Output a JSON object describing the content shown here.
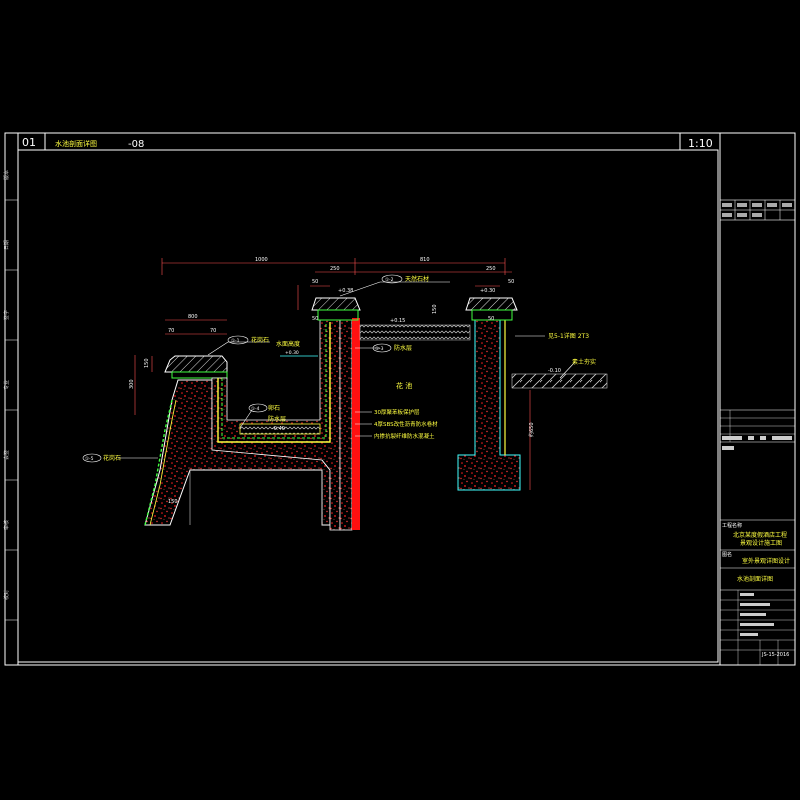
{
  "header": {
    "sheet_no": "01",
    "title": "水池剖面详图",
    "suffix": "-08",
    "scale": "1:10"
  },
  "dimensions": {
    "d1000": "1000",
    "d810": "810",
    "d250a": "250",
    "d250b": "250",
    "d50a": "50",
    "d50b": "50",
    "d30a": "30",
    "d30b": "30",
    "d800": "800",
    "d70a": "70",
    "d70b": "70",
    "d300": "300",
    "d150": "150",
    "d150b": "150",
    "d650": "约650",
    "d150c": "150",
    "d32a": "50",
    "d32b": "50",
    "lvl1": "+0.38",
    "lvl2": "+0.30",
    "lvl3": "-0.40",
    "lvl4": "-0.10",
    "lvl5": "+0.15"
  },
  "labels": {
    "callout_top": "天然石材",
    "callout_top_no": "①-2",
    "callout_left": "花岗石",
    "callout_left_no": "①-1",
    "callout_water": "水面高度",
    "callout_water_lvl": "+0.30",
    "callout_mid": "防水层",
    "callout_mid_no": "①-3",
    "callout_right": "见5-1详图 2T3",
    "callout_soil": "素土夯实",
    "center": "花 池",
    "pool_bottom1": "卵石",
    "pool_bottom2": "防水层",
    "pool_bottom_no": "①-4",
    "layer1": "30厚聚苯板保护层",
    "layer2": "4厚SBS改性沥青防水卷材",
    "layer3": "内掺抗裂纤维防水混凝土",
    "callout_left2": "花岗石",
    "callout_left2_no": "①-5"
  },
  "titleblock": {
    "project_label": "工程名称",
    "project": "北京某度假酒店工程",
    "project2": "景观设计施工图",
    "drawing_label": "图名",
    "drawing": "室外景观详图设计",
    "sheet_title": "水池剖面详图",
    "number": "JS-15-2016"
  },
  "colors": {
    "frame": "#ffffff",
    "dim": "#ff3030",
    "yellow": "#ffff40",
    "green": "#40ff40",
    "cyan": "#40ffff",
    "concrete": "#ff2020"
  }
}
